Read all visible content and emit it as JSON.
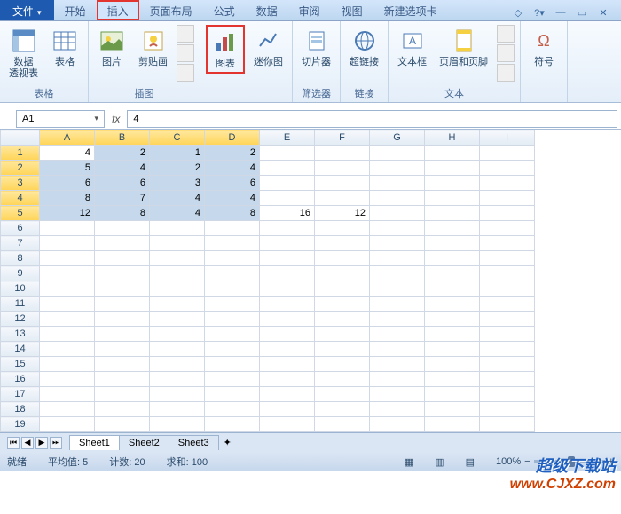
{
  "tabs": {
    "file": "文件",
    "start": "开始",
    "insert": "插入",
    "layout": "页面布局",
    "formula": "公式",
    "data": "数据",
    "review": "审阅",
    "view": "视图",
    "newtab": "新建选项卡"
  },
  "ribbon": {
    "pivot": "数据\n透视表",
    "table": "表格",
    "group_table": "表格",
    "picture": "图片",
    "clipart": "剪贴画",
    "group_illus": "插图",
    "chart": "图表",
    "sparkline": "迷你图",
    "slicer": "切片器",
    "group_filter": "筛选器",
    "hyperlink": "超链接",
    "group_link": "链接",
    "textbox": "文本框",
    "headerfooter": "页眉和页脚",
    "group_text": "文本",
    "symbol": "符号"
  },
  "namebox": "A1",
  "formula": "4",
  "cols": [
    "A",
    "B",
    "C",
    "D",
    "E",
    "F",
    "G",
    "H",
    "I"
  ],
  "rows": [
    1,
    2,
    3,
    4,
    5,
    6,
    7,
    8,
    9,
    10,
    11,
    12,
    13,
    14,
    15,
    16,
    17,
    18,
    19
  ],
  "cells": {
    "r1": [
      "4",
      "2",
      "1",
      "2",
      "",
      "",
      "",
      "",
      ""
    ],
    "r2": [
      "5",
      "4",
      "2",
      "4",
      "",
      "",
      "",
      "",
      ""
    ],
    "r3": [
      "6",
      "6",
      "3",
      "6",
      "",
      "",
      "",
      "",
      ""
    ],
    "r4": [
      "8",
      "7",
      "4",
      "4",
      "",
      "",
      "",
      "",
      ""
    ],
    "r5": [
      "12",
      "8",
      "4",
      "8",
      "16",
      "12",
      "",
      "",
      ""
    ]
  },
  "sheets": [
    "Sheet1",
    "Sheet2",
    "Sheet3"
  ],
  "status": {
    "ready": "就绪",
    "avg": "平均值: 5",
    "count": "计数: 20",
    "sum": "求和: 100",
    "zoom": "100%"
  },
  "watermark": {
    "t1": "超级下载站",
    "t2": "www.CJXZ.com"
  },
  "chart_data": {
    "type": "table",
    "selection": "A1:D5",
    "columns": [
      "A",
      "B",
      "C",
      "D"
    ],
    "rows": [
      [
        4,
        2,
        1,
        2
      ],
      [
        5,
        4,
        2,
        4
      ],
      [
        6,
        6,
        3,
        6
      ],
      [
        8,
        7,
        4,
        4
      ],
      [
        12,
        8,
        4,
        8
      ]
    ],
    "extra": {
      "E5": 16,
      "F5": 12
    }
  }
}
